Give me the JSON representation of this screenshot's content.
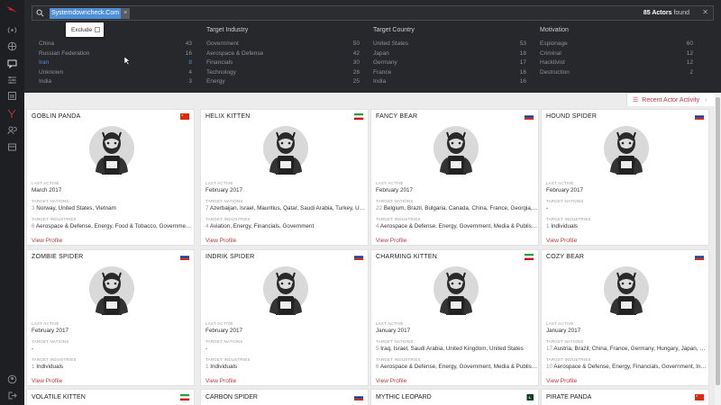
{
  "search": {
    "chip": "Systemdowncheck.Com",
    "count_number": "85 Actors",
    "count_suffix": "found"
  },
  "tooltip": {
    "label": "Exclude"
  },
  "filters": [
    {
      "header": "",
      "rows": [
        {
          "label": "China",
          "value": "43"
        },
        {
          "label": "Russian Federation",
          "value": "16"
        },
        {
          "label": "Iran",
          "value": "8",
          "selected": true
        },
        {
          "label": "Unknown",
          "value": "4"
        },
        {
          "label": "India",
          "value": "3"
        }
      ]
    },
    {
      "header": "Target Industry",
      "rows": [
        {
          "label": "Government",
          "value": "50"
        },
        {
          "label": "Aerospace & Defense",
          "value": "42"
        },
        {
          "label": "Financials",
          "value": "30"
        },
        {
          "label": "Technology",
          "value": "28"
        },
        {
          "label": "Energy",
          "value": "25"
        }
      ]
    },
    {
      "header": "Target Country",
      "rows": [
        {
          "label": "United States",
          "value": "53"
        },
        {
          "label": "Japan",
          "value": "18"
        },
        {
          "label": "Germany",
          "value": "17"
        },
        {
          "label": "France",
          "value": "16"
        },
        {
          "label": "India",
          "value": "16"
        }
      ]
    },
    {
      "header": "Motivation",
      "rows": [
        {
          "label": "Espionage",
          "value": "60"
        },
        {
          "label": "Criminal",
          "value": "12"
        },
        {
          "label": "Hacktivist",
          "value": "12"
        },
        {
          "label": "Destruction",
          "value": "2"
        }
      ]
    }
  ],
  "recent": {
    "label": "Recent Actor Activity"
  },
  "labels": {
    "last_active": "LAST ACTIVE",
    "target_nations": "TARGET NATIONS",
    "target_industries": "TARGET INDUSTRIES",
    "view_profile": "View Profile"
  },
  "cards": [
    {
      "name": "GOBLIN PANDA",
      "flag": "cn",
      "last_active": "March 2017",
      "nations_num": "3",
      "nations": "Norway, United States, Vietnam",
      "ind_num": "6",
      "industries": "Aerospace & Defense, Energy, Food & Tobacco, Government, M..."
    },
    {
      "name": "HELIX KITTEN",
      "flag": "ir",
      "last_active": "February 2017",
      "nations_num": "7",
      "nations": "Azerbaijan, Israel, Mauritius, Qatar, Saudi Arabia, Turkey, Uni...",
      "ind_num": "4",
      "industries": "Aviation, Energy, Financials, Government"
    },
    {
      "name": "FANCY BEAR",
      "flag": "ru",
      "last_active": "February 2017",
      "nations_num": "22",
      "nations": "Belgium, Brazil, Bulgaria, Canada, China, France, Georgia, G...",
      "ind_num": "4",
      "industries": "Aerospace & Defense, Energy, Government, Media & Publishi..."
    },
    {
      "name": "HOUND SPIDER",
      "flag": "ru",
      "last_active": "February 2017",
      "nations_num": "",
      "nations": "-",
      "ind_num": "1",
      "industries": "Individuals"
    },
    {
      "name": "ZOMBIE SPIDER",
      "flag": "ru",
      "last_active": "February 2017",
      "nations_num": "",
      "nations": "-",
      "ind_num": "1",
      "industries": "Individuals"
    },
    {
      "name": "INDRIK SPIDER",
      "flag": "ru",
      "last_active": "February 2017",
      "nations_num": "",
      "nations": "-",
      "ind_num": "1",
      "industries": "Individuals"
    },
    {
      "name": "CHARMING KITTEN",
      "flag": "ir",
      "last_active": "January 2017",
      "nations_num": "5",
      "nations": "Iraq, Israel, Saudi Arabia, United Kingdom, United States",
      "ind_num": "6",
      "industries": "Aerospace & Defense, Energy, Government, Media & Publishi..."
    },
    {
      "name": "COZY BEAR",
      "flag": "ru",
      "last_active": "January 2017",
      "nations_num": "17",
      "nations": "Austria, Brazil, China, France, Germany, Hungary, Japan, Me...",
      "ind_num": "10",
      "industries": "Aerospace & Defense, Energy, Financials, Government, Indu..."
    }
  ],
  "partial_cards": [
    {
      "name": "VOLATILE KITTEN",
      "flag": "ir"
    },
    {
      "name": "CARBON SPIDER",
      "flag": "ru"
    },
    {
      "name": "MYTHIC LEOPARD",
      "flag": "pk"
    },
    {
      "name": "PIRATE PANDA",
      "flag": "cn"
    }
  ],
  "colors": {
    "accent": "#c8363d",
    "selected": "#4e8fd6",
    "sidebar": "#1d1f22",
    "filter_bg": "#26282c"
  },
  "sidebar_icons": [
    "broadcast-icon",
    "globe-icon",
    "chat-icon",
    "sliders-icon",
    "report-icon",
    "crowdstrike-logo-icon",
    "users-icon",
    "layers-icon",
    "user-icon",
    "logout-icon"
  ]
}
